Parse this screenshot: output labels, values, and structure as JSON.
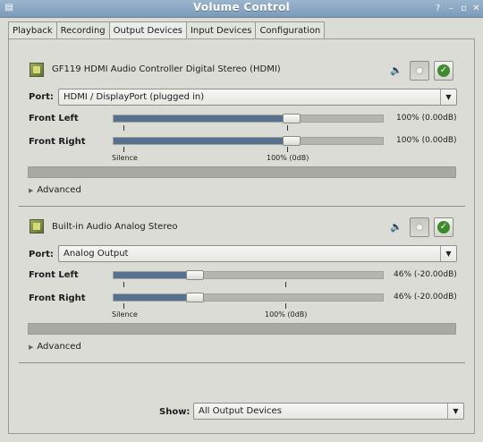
{
  "window": {
    "title": "Volume Control",
    "menu_icon": "window-menu-icon",
    "buttons": [
      "help-icon",
      "minimize-icon",
      "maximize-icon",
      "close-icon"
    ]
  },
  "tabs": [
    {
      "label": "Playback"
    },
    {
      "label": "Recording"
    },
    {
      "label": "Output Devices"
    },
    {
      "label": "Input Devices"
    },
    {
      "label": "Configuration"
    }
  ],
  "active_tab": "Output Devices",
  "devices": [
    {
      "name": "GF119 HDMI Audio Controller Digital Stereo (HDMI)",
      "port_label": "Port:",
      "port_value": "HDMI / DisplayPort (plugged in)",
      "channels": [
        {
          "label": "Front Left",
          "level": 1.0,
          "value_text": "100% (0.00dB)"
        },
        {
          "label": "Front Right",
          "level": 1.0,
          "value_text": "100% (0.00dB)"
        }
      ],
      "marks": {
        "silence": "Silence",
        "full": "100% (0dB)"
      },
      "peak_level": 0.0,
      "advanced_label": "Advanced",
      "is_default": true
    },
    {
      "name": "Built-in Audio Analog Stereo",
      "port_label": "Port:",
      "port_value": "Analog Output",
      "channels": [
        {
          "label": "Front Left",
          "level": 0.46,
          "value_text": "46% (-20.00dB)"
        },
        {
          "label": "Front Right",
          "level": 0.46,
          "value_text": "46% (-20.00dB)"
        }
      ],
      "marks": {
        "silence": "Silence",
        "full": "100% (0dB)"
      },
      "peak_level": 0.0,
      "advanced_label": "Advanced",
      "is_default": true
    }
  ],
  "footer": {
    "show_label": "Show:",
    "show_value": "All Output Devices"
  },
  "colors": {
    "titlebar": "#7c9ab8",
    "slider_fill": "#56708f",
    "default_check": "#3f8a2f",
    "background": "#dcdcd7"
  }
}
